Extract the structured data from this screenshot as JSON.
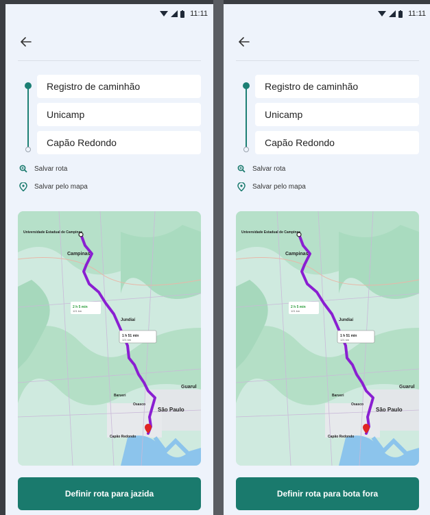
{
  "status": {
    "time": "11:11"
  },
  "screens": [
    {
      "route": {
        "title": "Registro de caminhão",
        "origin": "Unicamp",
        "destination": "Capão Redondo"
      },
      "actions": {
        "save_route": "Salvar rota",
        "save_by_map": "Salvar pelo mapa"
      },
      "map_labels": {
        "university": "Universidade Estadual de Campinas",
        "campinas": "Campinas",
        "eta1": "2 h 5 min",
        "eta1_dist": "121 km",
        "eta2": "1 h 51 min",
        "eta2_dist": "121 km",
        "jundiai": "Jundiaí",
        "barueri": "Barueri",
        "osasco": "Osasco",
        "sao_paulo": "São Paulo",
        "capao": "Capão Redondo",
        "guarulhos": "Guarul"
      },
      "cta": "Definir rota para jazida"
    },
    {
      "route": {
        "title": "Registro de caminhão",
        "origin": "Unicamp",
        "destination": "Capão Redondo"
      },
      "actions": {
        "save_route": "Salvar rota",
        "save_by_map": "Salvar pelo mapa"
      },
      "map_labels": {
        "university": "Universidade Estadual de Campinas",
        "campinas": "Campinas",
        "eta1": "2 h 5 min",
        "eta1_dist": "121 km",
        "eta2": "1 h 51 min",
        "eta2_dist": "121 km",
        "jundiai": "Jundiaí",
        "barueri": "Barueri",
        "osasco": "Osasco",
        "sao_paulo": "São Paulo",
        "capao": "Capão Redondo",
        "guarulhos": "Guarul"
      },
      "cta": "Definir rota para bota fora"
    }
  ],
  "colors": {
    "accent": "#1a7a6d",
    "route": "#8a1fd1",
    "map_green": "#bfe6d6",
    "background": "#eef3fb"
  },
  "icons": {
    "back": "arrow-left-icon",
    "save_route": "search-zoom-icon",
    "save_by_map": "map-pin-icon",
    "wifi": "wifi-icon",
    "signal": "signal-icon",
    "battery": "battery-icon"
  }
}
